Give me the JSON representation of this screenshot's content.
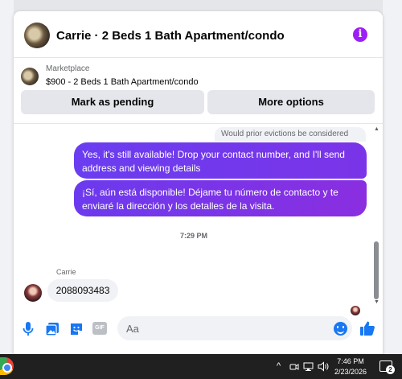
{
  "header": {
    "title": "Carrie · 2 Beds 1 Bath Apartment/condo",
    "info_icon": "info-icon"
  },
  "listing": {
    "source": "Marketplace",
    "price_title": "$900 - 2 Beds 1 Bath Apartment/condo"
  },
  "actions": {
    "pending_label": "Mark as pending",
    "more_label": "More options"
  },
  "messages": {
    "reply_preview": "Would prior evictions be considered",
    "outgoing": [
      "Yes, it's still available! Drop your contact number, and I'll send address and viewing details",
      "¡Sí, aún está disponible! Déjame tu número de contacto y te enviaré la dirección y los detalles de la visita."
    ],
    "timestamp": "7:29 PM",
    "incoming_sender": "Carrie",
    "incoming_text": "2088093483"
  },
  "composer": {
    "placeholder": "Aa",
    "gif_label": "GIF",
    "icons": [
      "microphone-icon",
      "photo-icon",
      "sticker-icon",
      "gif-icon",
      "emoji-icon",
      "like-icon"
    ]
  },
  "taskbar": {
    "time": "7:46 PM",
    "date": "2/23/2026",
    "notification_count": "2",
    "tray_chevron": "^"
  },
  "colors": {
    "accent": "#1877f2",
    "bubble_purple": "#6a3df0",
    "info_purple": "#9b20f5"
  }
}
